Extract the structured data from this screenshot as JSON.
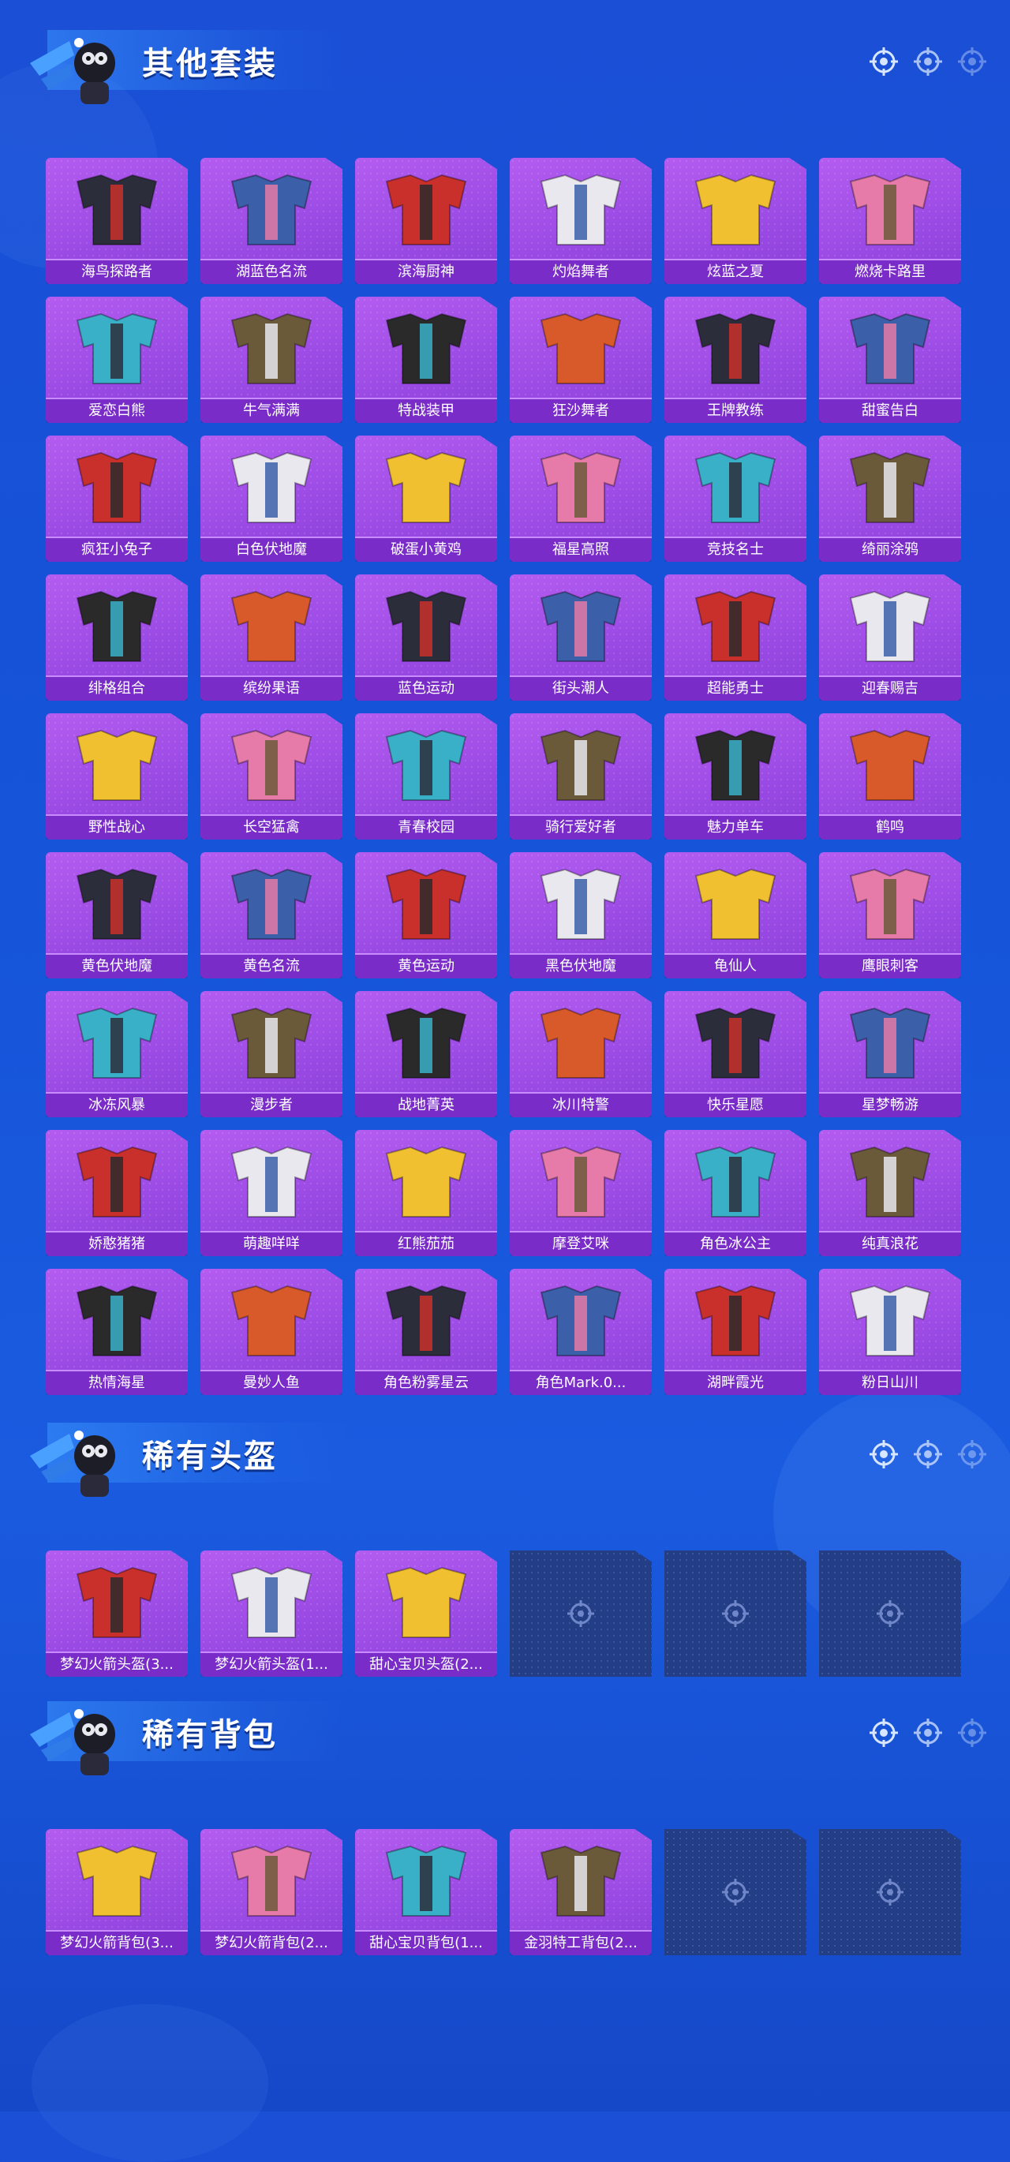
{
  "sections": {
    "other_suits": {
      "title": "其他套装",
      "items": [
        "海鸟探路者",
        "湖蓝色名流",
        "滨海厨神",
        "灼焰舞者",
        "炫蓝之夏",
        "燃烧卡路里",
        "爱恋白熊",
        "牛气满满",
        "特战装甲",
        "狂沙舞者",
        "王牌教练",
        "甜蜜告白",
        "疯狂小兔子",
        "白色伏地魔",
        "破蛋小黄鸡",
        "福星高照",
        "竞技名士",
        "绮丽涂鸦",
        "绯格组合",
        "缤纷果语",
        "蓝色运动",
        "街头潮人",
        "超能勇士",
        "迎春赐吉",
        "野性战心",
        "长空猛禽",
        "青春校园",
        "骑行爱好者",
        "魅力单车",
        "鹤鸣",
        "黄色伏地魔",
        "黄色名流",
        "黄色运动",
        "黑色伏地魔",
        "龟仙人",
        "鹰眼刺客",
        "冰冻风暴",
        "漫步者",
        "战地菁英",
        "冰川特警",
        "快乐星愿",
        "星梦畅游",
        "娇憨猪猪",
        "萌趣咩咩",
        "红熊茄茄",
        "摩登艾咪",
        "角色冰公主",
        "纯真浪花",
        "热情海星",
        "曼妙人鱼",
        "角色粉雾星云",
        "角色Mark.0...",
        "湖畔霞光",
        "粉日山川"
      ]
    },
    "rare_helmets": {
      "title": "稀有头盔",
      "items": [
        "梦幻火箭头盔(3...",
        "梦幻火箭头盔(1...",
        "甜心宝贝头盔(2..."
      ]
    },
    "rare_backpacks": {
      "title": "稀有背包",
      "items": [
        "梦幻火箭背包(3...",
        "梦幻火箭背包(2...",
        "甜心宝贝背包(1...",
        "金羽特工背包(2..."
      ]
    }
  },
  "icons": {
    "section_markers": "crosshair-target-icon",
    "empty_slot": "crosshair-target-icon",
    "mascot": "skydiver-mascot-icon"
  },
  "colors": {
    "background": "#1553d8",
    "card_purple": "#a050e8",
    "label_purple": "#7a2cc8",
    "empty_slot": "#243e86"
  }
}
